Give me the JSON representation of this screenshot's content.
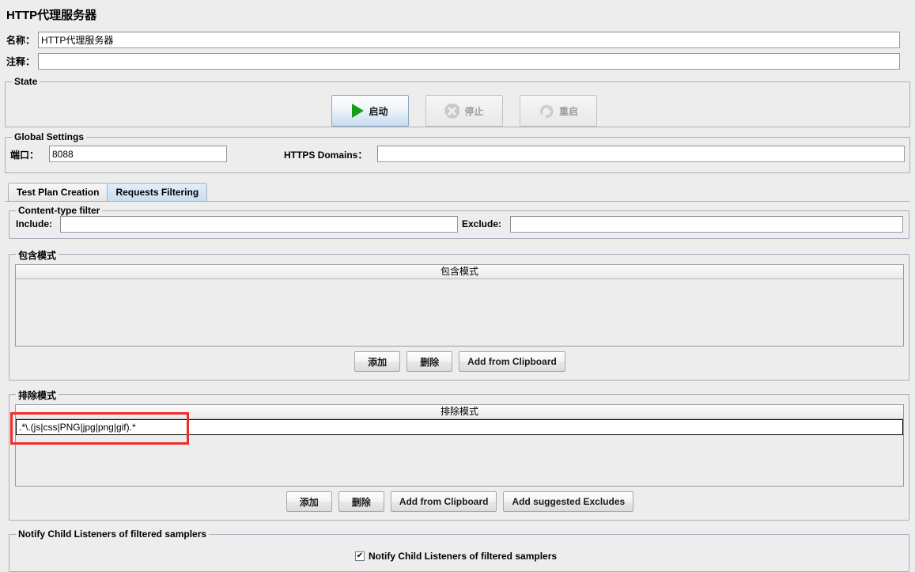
{
  "header": {
    "title": "HTTP代理服务器"
  },
  "fields": {
    "name_label": "名称：",
    "name_value": "HTTP代理服务器",
    "comment_label": "注释：",
    "comment_value": ""
  },
  "state": {
    "group_title": "State",
    "start_label": "启动",
    "stop_label": "停止",
    "restart_label": "重启",
    "start_icon": "play-icon",
    "stop_icon": "stop-icon",
    "restart_icon": "restart-icon"
  },
  "global_settings": {
    "group_title": "Global Settings",
    "port_label": "端口：",
    "port_value": "8088",
    "https_domains_label": "HTTPS Domains：",
    "https_domains_value": ""
  },
  "tabs": [
    {
      "label": "Test Plan Creation",
      "active": false
    },
    {
      "label": "Requests Filtering",
      "active": true
    }
  ],
  "content_type_filter": {
    "group_title": "Content-type filter",
    "include_label": "Include:",
    "include_value": "",
    "exclude_label": "Exclude:",
    "exclude_value": ""
  },
  "include_patterns": {
    "group_title": "包含模式",
    "column_header": "包含模式",
    "rows": [],
    "buttons": [
      {
        "label": "添加"
      },
      {
        "label": "删除"
      },
      {
        "label": "Add from Clipboard"
      }
    ]
  },
  "exclude_patterns": {
    "group_title": "排除模式",
    "column_header": "排除模式",
    "rows": [
      {
        "value": ".*\\.(js|css|PNG|jpg|png|gif).*",
        "editing": true
      }
    ],
    "buttons": [
      {
        "label": "添加"
      },
      {
        "label": "删除"
      },
      {
        "label": "Add from Clipboard"
      },
      {
        "label": "Add suggested Excludes"
      }
    ]
  },
  "notify": {
    "group_title": "Notify Child Listeners of filtered samplers",
    "checkbox_label": "Notify Child Listeners of filtered samplers",
    "checked": true,
    "check_glyph": "✔"
  },
  "colors": {
    "background": "#ededed",
    "annotation": "#f42b2b",
    "tab_active": "#c9def2",
    "play_green": "#14a014"
  }
}
